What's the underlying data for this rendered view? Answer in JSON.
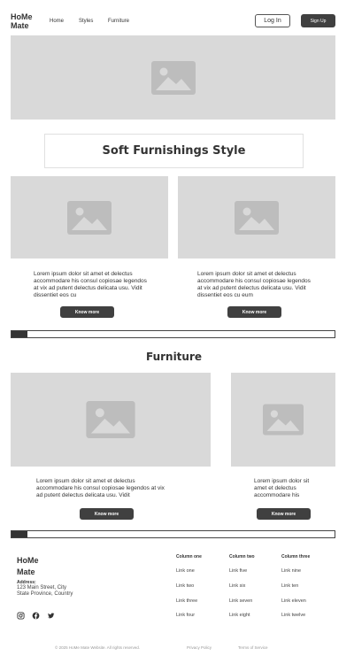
{
  "header": {
    "logo_line1": "HoMe",
    "logo_line2": "Mate",
    "nav": [
      "Home",
      "Styles",
      "Furniture"
    ],
    "login_label": "Log In",
    "signup_label": "Sign Up"
  },
  "hero": {
    "image_icon": "image-placeholder-icon"
  },
  "soft_section": {
    "title": "Soft Furnishings Style",
    "cards": [
      {
        "text": "Lorem ipsum dolor sit amet et delectus accommodare his consul copiosae legendos at vix ad putent delectus delicata usu. Vidit dissentiet eos cu",
        "button": "Know more"
      },
      {
        "text": "Lorem ipsum dolor sit amet et delectus accommodare his consul copiosae legendos at vix ad putent delectus delicata usu. Vidit dissentiet eos cu eum",
        "button": "Know more"
      }
    ]
  },
  "furniture_section": {
    "title": "Furniture",
    "cards": [
      {
        "text": "Lorem ipsum dolor sit amet et delectus accommodare his consul copiosae legendos at vix ad putent delectus delicata usu. Vidit",
        "button": "Know more"
      },
      {
        "text": "Lorem ipsum dolor sit amet et delectus accommodare his",
        "button": "Know more"
      }
    ]
  },
  "footer": {
    "logo_line1": "HoMe",
    "logo_line2": "Mate",
    "address_label": "Address:",
    "address_line1": "123 Main Street, City",
    "address_line2": "State Province, Country",
    "socials": [
      "instagram-icon",
      "facebook-icon",
      "twitter-icon"
    ],
    "columns": [
      {
        "title": "Column one",
        "links": [
          "Link one",
          "Link two",
          "Link three",
          "Link four"
        ]
      },
      {
        "title": "Column two",
        "links": [
          "Link five",
          "Link six",
          "Link seven",
          "Link eight"
        ]
      },
      {
        "title": "Column three",
        "links": [
          "Link nine",
          "Link ten",
          "Link eleven",
          "Link twelve"
        ]
      }
    ],
    "copyright": "© 2025 HoMe Mate Website. All rights reserved.",
    "privacy": "Privacy Policy",
    "terms": "Terms of Service"
  }
}
